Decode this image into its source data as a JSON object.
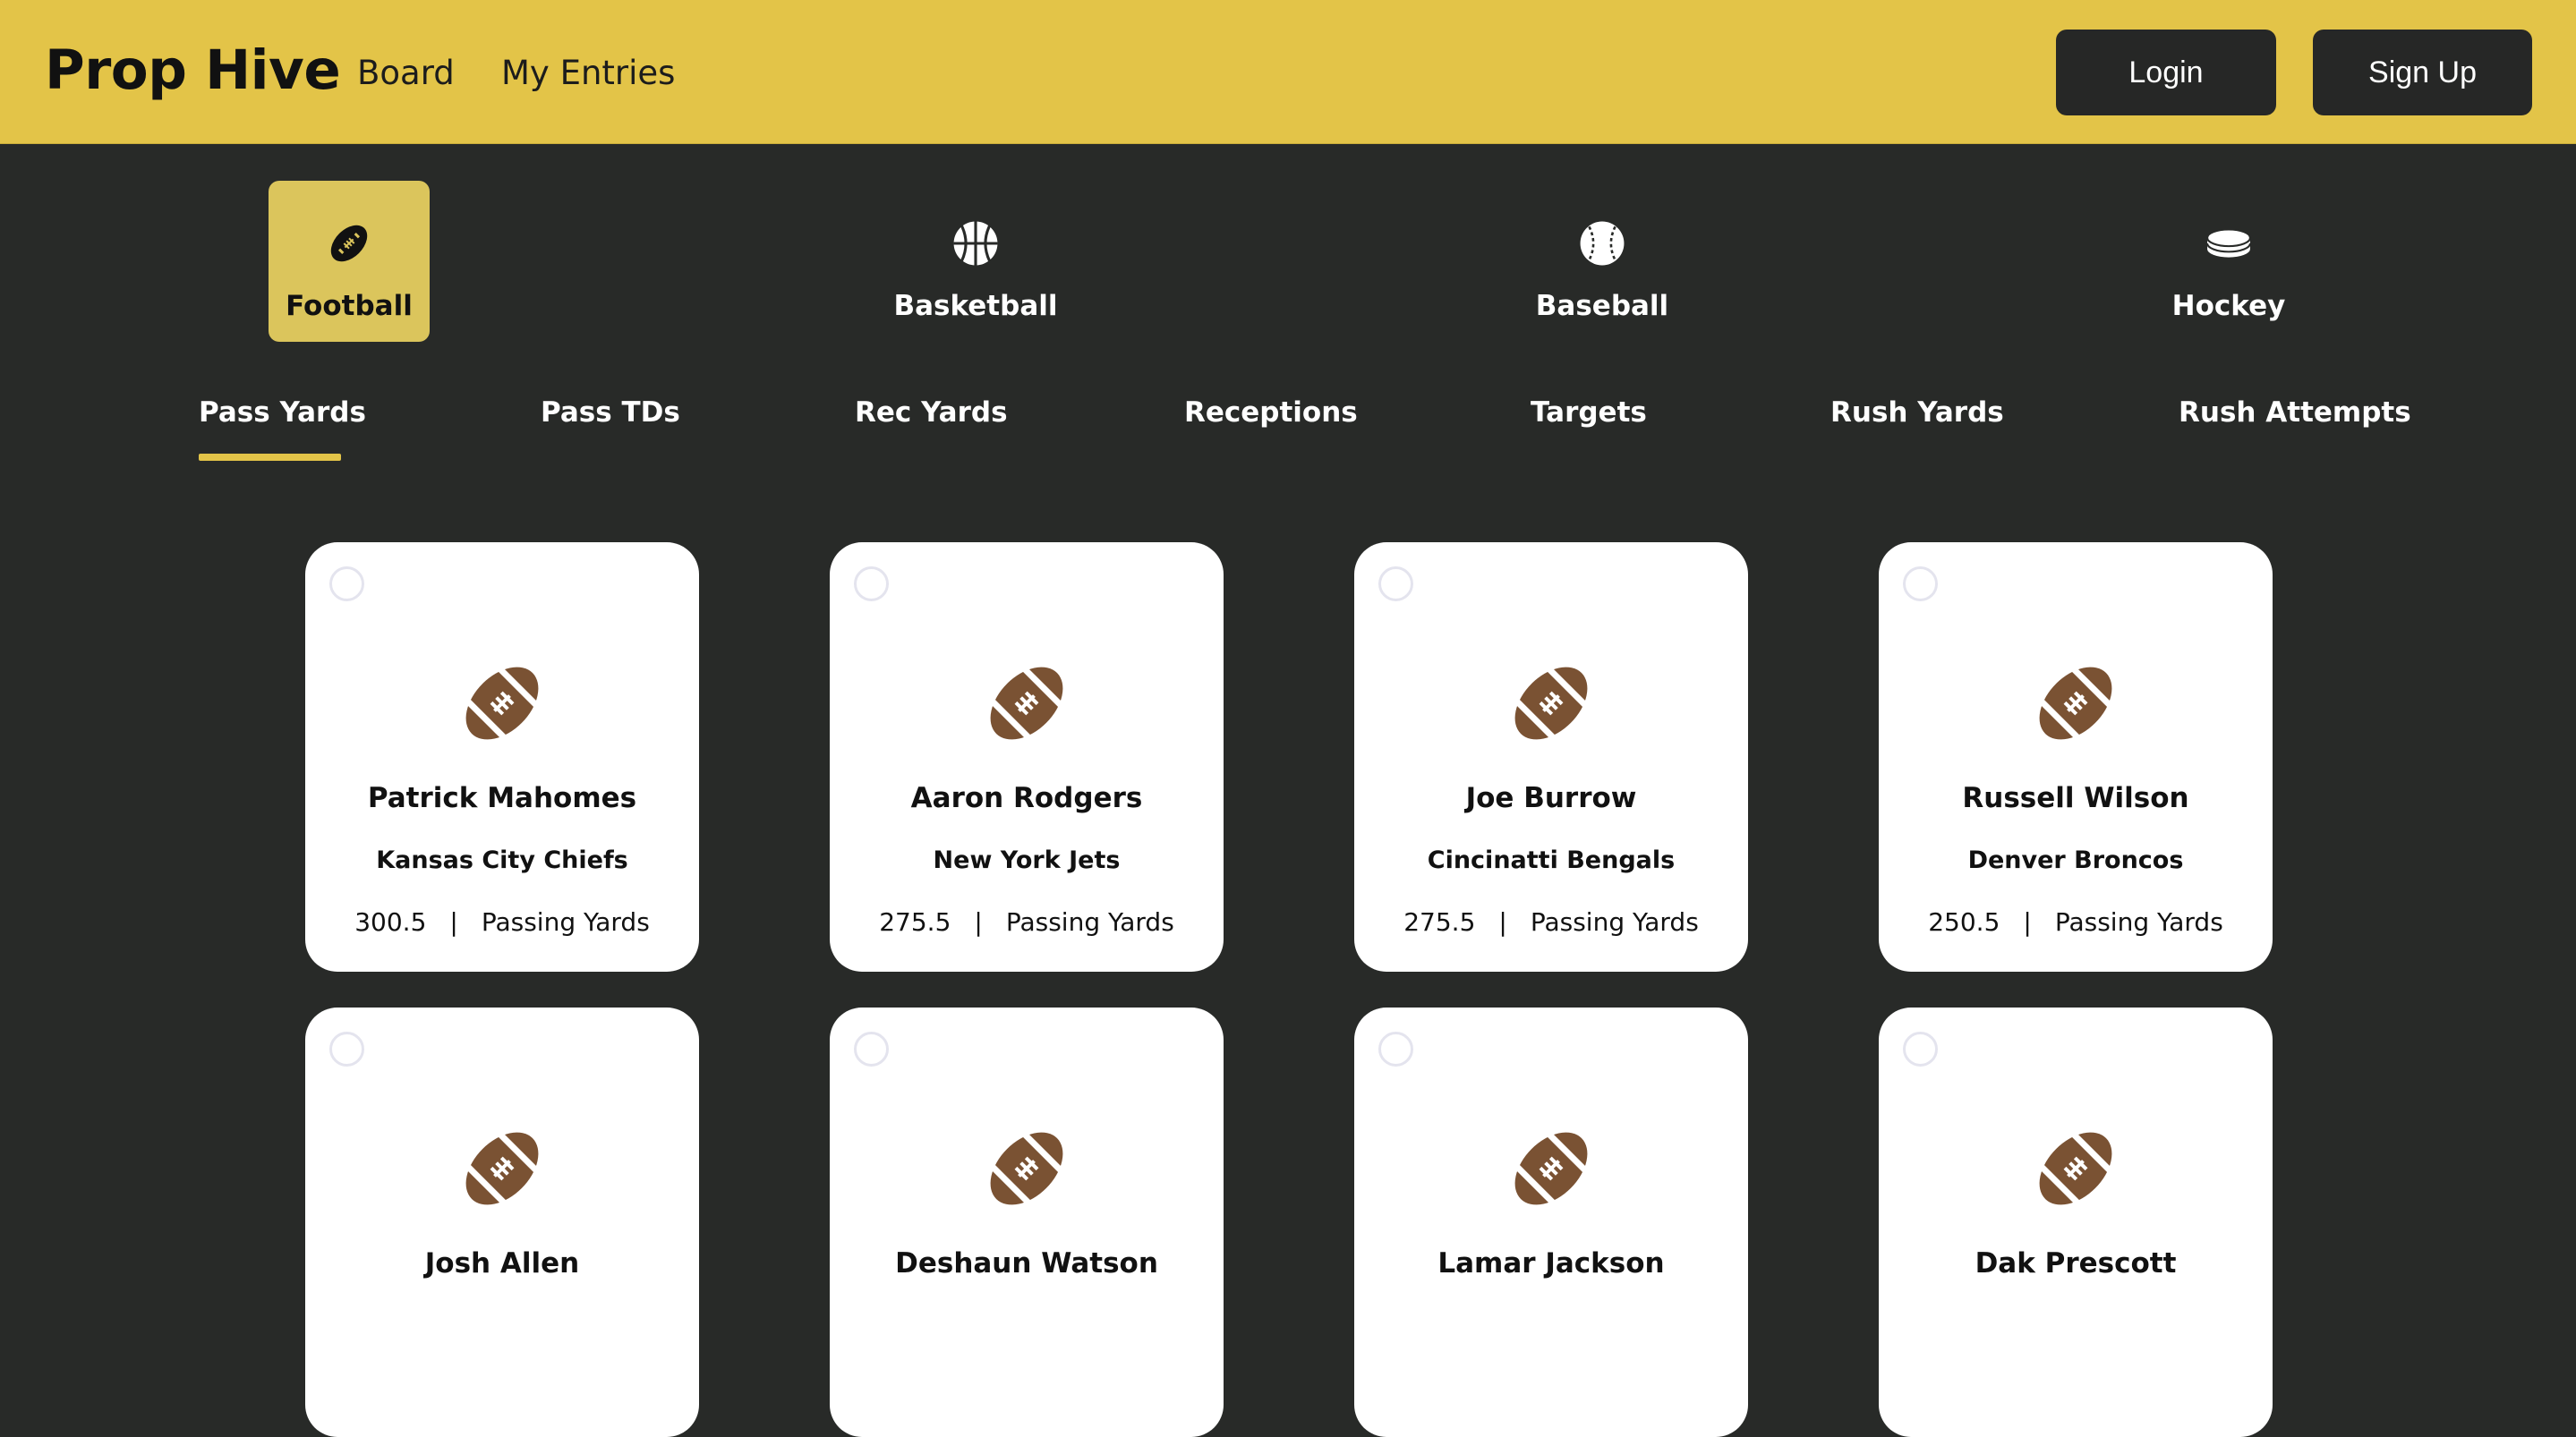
{
  "header": {
    "brand": "Prop Hive",
    "nav": [
      "Board",
      "My Entries"
    ],
    "login_label": "Login",
    "signup_label": "Sign Up"
  },
  "sports": [
    {
      "label": "Football",
      "icon": "football-icon",
      "active": true
    },
    {
      "label": "Basketball",
      "icon": "basketball-icon",
      "active": false
    },
    {
      "label": "Baseball",
      "icon": "baseball-icon",
      "active": false
    },
    {
      "label": "Hockey",
      "icon": "hockey-puck-icon",
      "active": false
    }
  ],
  "stat_tabs": [
    "Pass Yards",
    "Pass TDs",
    "Rec Yards",
    "Receptions",
    "Targets",
    "Rush Yards",
    "Rush Attempts"
  ],
  "active_tab": "Pass Yards",
  "players": [
    {
      "name": "Patrick Mahomes",
      "team": "Kansas City Chiefs",
      "line": "300.5",
      "stat": "Passing Yards"
    },
    {
      "name": "Aaron Rodgers",
      "team": "New York Jets",
      "line": "275.5",
      "stat": "Passing Yards"
    },
    {
      "name": "Joe Burrow",
      "team": "Cincinatti Bengals",
      "line": "275.5",
      "stat": "Passing Yards"
    },
    {
      "name": "Russell Wilson",
      "team": "Denver Broncos",
      "line": "250.5",
      "stat": "Passing Yards"
    },
    {
      "name": "Josh Allen"
    },
    {
      "name": "Deshaun Watson"
    },
    {
      "name": "Lamar Jackson"
    },
    {
      "name": "Dak Prescott"
    }
  ],
  "line_separator": "|",
  "colors": {
    "header_bg": "#e3c448",
    "page_bg": "#282a28",
    "active_sport_bg": "#dbc55c",
    "tab_underline": "#e3c448",
    "football_brown": "#7a5233"
  }
}
